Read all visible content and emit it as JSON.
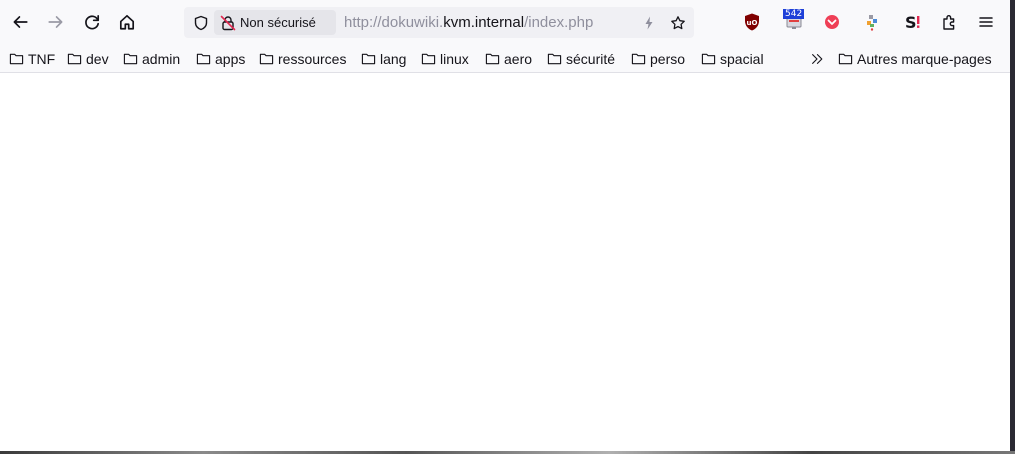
{
  "toolbar": {
    "back_icon": "arrow-left-icon",
    "forward_icon": "arrow-right-icon",
    "reload_icon": "reload-icon",
    "home_icon": "home-icon"
  },
  "urlbar": {
    "security_label": "Non sécurisé",
    "url_prefix": "http://dokuwiki.",
    "url_host": "kvm.internal",
    "url_suffix": "/index.php"
  },
  "extensions": {
    "ublock_badge": "542"
  },
  "bookmarks": {
    "items": [
      {
        "label": "TNF"
      },
      {
        "label": "dev"
      },
      {
        "label": "admin"
      },
      {
        "label": "apps"
      },
      {
        "label": "ressources"
      },
      {
        "label": "lang"
      },
      {
        "label": "linux"
      },
      {
        "label": "aero"
      },
      {
        "label": "sécurité"
      },
      {
        "label": "perso"
      },
      {
        "label": "spacial"
      }
    ],
    "other_label": "Autres marque-pages"
  },
  "colors": {
    "toolbar_bg": "#f9f9fb",
    "urlbar_bg": "#f0f0f4",
    "text": "#15141a",
    "url_dim": "#8f8f9d"
  }
}
